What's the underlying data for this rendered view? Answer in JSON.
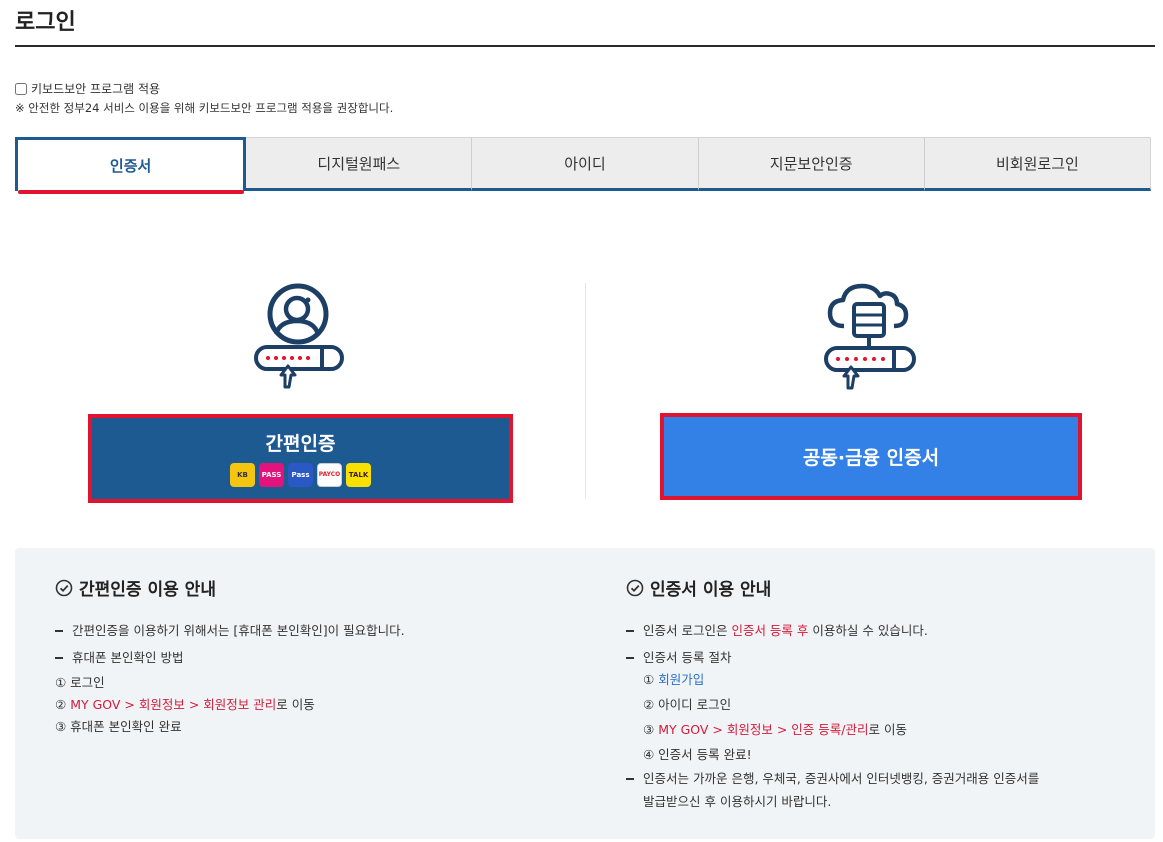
{
  "page": {
    "title": "로그인"
  },
  "keyboard": {
    "checkbox_label": "키보드보안 프로그램 적용",
    "note": "※ 안전한 정부24 서비스 이용을 위해 키보드보안 프로그램 적용을 권장합니다."
  },
  "tabs": [
    {
      "label": "인증서",
      "active": true
    },
    {
      "label": "디지털원패스",
      "active": false
    },
    {
      "label": "아이디",
      "active": false
    },
    {
      "label": "지문보안인증",
      "active": false
    },
    {
      "label": "비회원로그인",
      "active": false
    }
  ],
  "buttons": {
    "simple_auth": "간편인증",
    "providers": {
      "kb": "KB",
      "pass": "PASS",
      "samsung_pass": "Pass",
      "payco": "PAYCO",
      "kakao": "TALK"
    },
    "certificate": "공동·금융 인증서"
  },
  "guide_simple": {
    "title": "간편인증 이용 안내",
    "line1": "간편인증을 이용하기 위해서는 [휴대폰 본인확인]이 필요합니다.",
    "line2": "휴대폰 본인확인 방법",
    "step1": "① 로그인",
    "step2_num": "② ",
    "step2_red": "MY GOV > 회원정보 > 회원정보 관리",
    "step2_rest": "로 이동",
    "step3": "③ 휴대폰 본인확인 완료"
  },
  "guide_cert": {
    "title": "인증서 이용 안내",
    "line1_pre": "인증서 로그인은 ",
    "line1_red": "인증서 등록 후",
    "line1_post": " 이용하실 수 있습니다.",
    "line2": "인증서 등록 절차",
    "step1_num": "① ",
    "step1_link": "회원가입",
    "step2": "② 아이디 로그인",
    "step3_num": "③ ",
    "step3_red": "MY GOV > 회원정보 > 인증 등록/관리",
    "step3_rest": "로 이동",
    "step4": "④ 인증서 등록 완료!",
    "line3": "인증서는 가까운 은행, 우체국, 증권사에서 인터넷뱅킹, 증권거래용 인증서를",
    "line3b": "발급받으신 후 이용하시기 바랍니다."
  }
}
